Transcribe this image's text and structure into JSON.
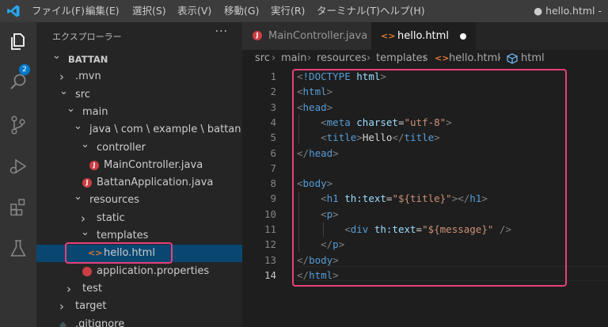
{
  "titlebar": {
    "menus": [
      "ファイル(F)",
      "編集(E)",
      "選択(S)",
      "表示(V)",
      "移動(G)",
      "実行(R)",
      "ターミナル(T)",
      "ヘルプ(H)"
    ],
    "window_title": "● hello.html -"
  },
  "activity_bar": {
    "icons": [
      "explorer-icon",
      "search-icon",
      "source-control-icon",
      "run-debug-icon",
      "extensions-icon",
      "testing-icon"
    ],
    "explorer_badge": "2"
  },
  "sidebar": {
    "header": "エクスプローラー",
    "more": "···",
    "tree": [
      {
        "label": "BATTAN",
        "kind": "root",
        "expanded": true
      },
      {
        "label": ".mvn",
        "kind": "folder",
        "expanded": false
      },
      {
        "label": "src",
        "kind": "folder",
        "expanded": true
      },
      {
        "label": "main",
        "kind": "folder",
        "expanded": true
      },
      {
        "label": "java \\ com \\ example \\ battan",
        "kind": "folder",
        "expanded": true
      },
      {
        "label": "controller",
        "kind": "folder",
        "expanded": true
      },
      {
        "label": "MainController.java",
        "kind": "java"
      },
      {
        "label": "BattanApplication.java",
        "kind": "java"
      },
      {
        "label": "resources",
        "kind": "folder",
        "expanded": true
      },
      {
        "label": "static",
        "kind": "folder",
        "expanded": false
      },
      {
        "label": "templates",
        "kind": "folder",
        "expanded": true
      },
      {
        "label": "hello.html",
        "kind": "html",
        "selected": true
      },
      {
        "label": "application.properties",
        "kind": "properties"
      },
      {
        "label": "test",
        "kind": "folder",
        "expanded": false
      },
      {
        "label": "target",
        "kind": "folder",
        "expanded": false
      },
      {
        "label": ".gitignore",
        "kind": "git"
      }
    ]
  },
  "tabs": [
    {
      "label": "MainController.java",
      "icon": "java-file-icon",
      "active": false
    },
    {
      "label": "hello.html",
      "icon": "html-file-icon",
      "active": true,
      "dirty": true
    }
  ],
  "breadcrumb": [
    "src",
    "main",
    "resources",
    "templates",
    "hello.html",
    "html"
  ],
  "editor": {
    "current_line": 14,
    "lines": [
      {
        "n": "1",
        "tokens": [
          [
            "t-punct",
            "<"
          ],
          [
            "t-tag",
            "!DOCTYPE "
          ],
          [
            "t-attr",
            "html"
          ],
          [
            "t-punct",
            ">"
          ]
        ]
      },
      {
        "n": "2",
        "tokens": [
          [
            "t-punct",
            "<"
          ],
          [
            "t-tag",
            "html"
          ],
          [
            "t-punct",
            ">"
          ]
        ]
      },
      {
        "n": "3",
        "tokens": [
          [
            "t-punct",
            "<"
          ],
          [
            "t-tag",
            "head"
          ],
          [
            "t-punct",
            ">"
          ]
        ]
      },
      {
        "n": "4",
        "tokens": [
          [
            "t-text",
            "    "
          ],
          [
            "t-punct",
            "<"
          ],
          [
            "t-tag",
            "meta "
          ],
          [
            "t-attr",
            "charset"
          ],
          [
            "t-text",
            "="
          ],
          [
            "t-str",
            "\"utf-8\""
          ],
          [
            "t-punct",
            ">"
          ]
        ]
      },
      {
        "n": "5",
        "tokens": [
          [
            "t-text",
            "    "
          ],
          [
            "t-punct",
            "<"
          ],
          [
            "t-tag",
            "title"
          ],
          [
            "t-punct",
            ">"
          ],
          [
            "t-text",
            "Hello"
          ],
          [
            "t-punct",
            "</"
          ],
          [
            "t-tag",
            "title"
          ],
          [
            "t-punct",
            ">"
          ]
        ]
      },
      {
        "n": "6",
        "tokens": [
          [
            "t-punct",
            "</"
          ],
          [
            "t-tag",
            "head"
          ],
          [
            "t-punct",
            ">"
          ]
        ]
      },
      {
        "n": "7",
        "tokens": []
      },
      {
        "n": "8",
        "tokens": [
          [
            "t-punct",
            "<"
          ],
          [
            "t-tag",
            "body"
          ],
          [
            "t-punct",
            ">"
          ]
        ]
      },
      {
        "n": "9",
        "tokens": [
          [
            "t-text",
            "    "
          ],
          [
            "t-punct",
            "<"
          ],
          [
            "t-tag",
            "h1 "
          ],
          [
            "t-attr",
            "th:text"
          ],
          [
            "t-text",
            "="
          ],
          [
            "t-str",
            "\"${title}\""
          ],
          [
            "t-punct",
            "></"
          ],
          [
            "t-tag",
            "h1"
          ],
          [
            "t-punct",
            ">"
          ]
        ]
      },
      {
        "n": "10",
        "tokens": [
          [
            "t-text",
            "    "
          ],
          [
            "t-punct",
            "<"
          ],
          [
            "t-tag",
            "p"
          ],
          [
            "t-punct",
            ">"
          ]
        ]
      },
      {
        "n": "11",
        "tokens": [
          [
            "t-text",
            "        "
          ],
          [
            "t-punct",
            "<"
          ],
          [
            "t-tag",
            "div "
          ],
          [
            "t-attr",
            "th:text"
          ],
          [
            "t-text",
            "="
          ],
          [
            "t-str",
            "\"${message}\""
          ],
          [
            "t-text",
            " "
          ],
          [
            "t-punct",
            "/>"
          ]
        ]
      },
      {
        "n": "12",
        "tokens": [
          [
            "t-text",
            "    "
          ],
          [
            "t-punct",
            "</"
          ],
          [
            "t-tag",
            "p"
          ],
          [
            "t-punct",
            ">"
          ]
        ]
      },
      {
        "n": "13",
        "tokens": [
          [
            "t-punct",
            "</"
          ],
          [
            "t-tag",
            "body"
          ],
          [
            "t-punct",
            ">"
          ]
        ]
      },
      {
        "n": "14",
        "tokens": [
          [
            "t-punct",
            "</"
          ],
          [
            "t-tag",
            "html"
          ],
          [
            "t-punct",
            ">"
          ]
        ]
      }
    ]
  },
  "colors": {
    "highlight": "#e5407b",
    "selection": "#094771",
    "badge": "#007acc"
  }
}
